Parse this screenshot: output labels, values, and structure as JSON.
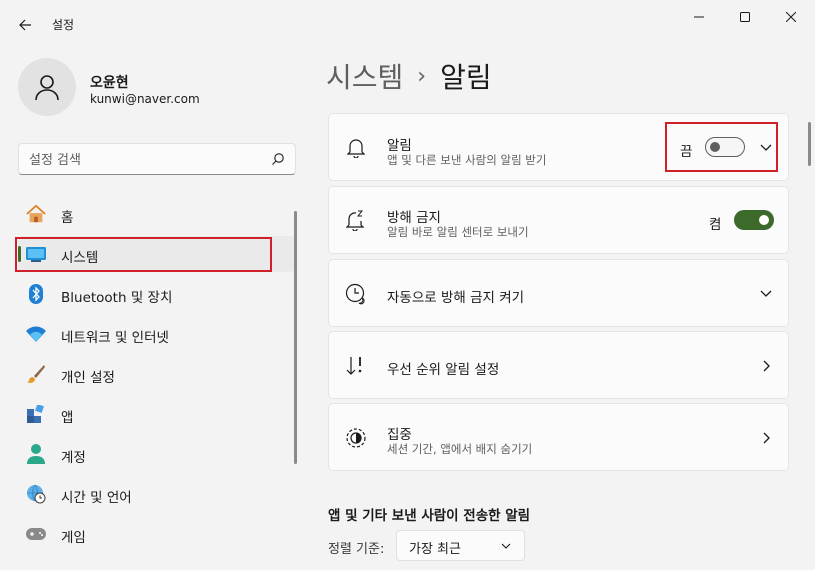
{
  "window": {
    "app_title": "설정"
  },
  "profile": {
    "name": "오윤현",
    "email": "kunwi@naver.com"
  },
  "search": {
    "placeholder": "설정 검색"
  },
  "sidebar": {
    "items": [
      {
        "label": "홈",
        "icon": "home-icon"
      },
      {
        "label": "시스템",
        "icon": "system-display-icon",
        "selected": true
      },
      {
        "label": "Bluetooth 및 장치",
        "icon": "bluetooth-icon"
      },
      {
        "label": "네트워크 및 인터넷",
        "icon": "wifi-icon"
      },
      {
        "label": "개인 설정",
        "icon": "paintbrush-icon"
      },
      {
        "label": "앱",
        "icon": "apps-icon"
      },
      {
        "label": "계정",
        "icon": "account-icon"
      },
      {
        "label": "시간 및 언어",
        "icon": "globe-clock-icon"
      },
      {
        "label": "게임",
        "icon": "gamepad-icon"
      }
    ]
  },
  "breadcrumb": {
    "parent": "시스템",
    "separator": "›",
    "current": "알림"
  },
  "cards": {
    "notifications": {
      "title": "알림",
      "subtitle": "앱 및 다른 보낸 사람의 알림 받기",
      "toggle_text": "끔",
      "toggle_on": false
    },
    "dnd": {
      "title": "방해 금지",
      "subtitle": "알림 바로 알림 센터로 보내기",
      "toggle_text": "켬",
      "toggle_on": true
    },
    "auto_dnd": {
      "title": "자동으로 방해 금지 켜기"
    },
    "priority": {
      "title": "우선 순위 알림 설정"
    },
    "focus": {
      "title": "집중",
      "subtitle": "세션 기간, 앱에서 배지 숨기기"
    }
  },
  "apps_section": {
    "title": "앱 및 기타 보낸 사람이 전송한 알림",
    "sort_label": "정렬 기준:",
    "sort_value": "가장 최근"
  },
  "colors": {
    "accent": "#3b6a2b",
    "highlight_border": "#d0202a"
  }
}
